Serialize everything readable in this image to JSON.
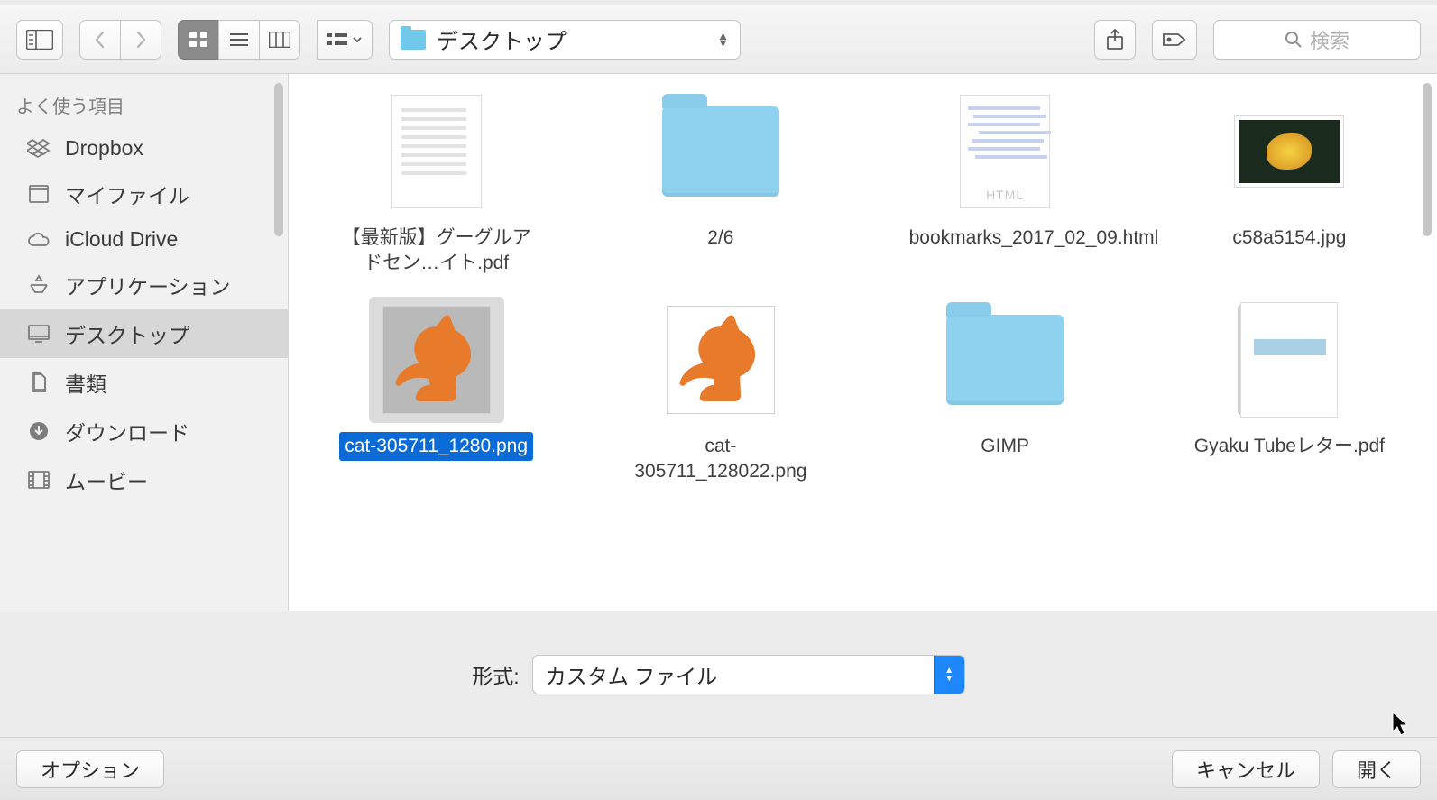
{
  "toolbar": {
    "current_path": "デスクトップ",
    "search_placeholder": "検索"
  },
  "sidebar": {
    "header": "よく使う項目",
    "items": [
      {
        "label": "Dropbox",
        "icon": "dropbox"
      },
      {
        "label": "マイファイル",
        "icon": "myfiles"
      },
      {
        "label": "iCloud Drive",
        "icon": "cloud"
      },
      {
        "label": "アプリケーション",
        "icon": "apps"
      },
      {
        "label": "デスクトップ",
        "icon": "desktop",
        "selected": true
      },
      {
        "label": "書類",
        "icon": "documents"
      },
      {
        "label": "ダウンロード",
        "icon": "downloads"
      },
      {
        "label": "ムービー",
        "icon": "movies"
      }
    ]
  },
  "files": [
    {
      "name": "【最新版】グーグルアドセン…イト.pdf",
      "kind": "doc"
    },
    {
      "name": "2/6",
      "kind": "folder"
    },
    {
      "name": "bookmarks_2017_02_09.html",
      "kind": "html"
    },
    {
      "name": "c58a5154.jpg",
      "kind": "image"
    },
    {
      "name": "cat-305711_1280.png",
      "kind": "png",
      "selected": true
    },
    {
      "name": "cat-305711_128022.png",
      "kind": "png"
    },
    {
      "name": "GIMP",
      "kind": "folder"
    },
    {
      "name": "Gyaku Tubeレター.pdf",
      "kind": "doc-ring"
    }
  ],
  "format": {
    "label": "形式:",
    "value": "カスタム ファイル"
  },
  "footer": {
    "options": "オプション",
    "cancel": "キャンセル",
    "open": "開く"
  }
}
